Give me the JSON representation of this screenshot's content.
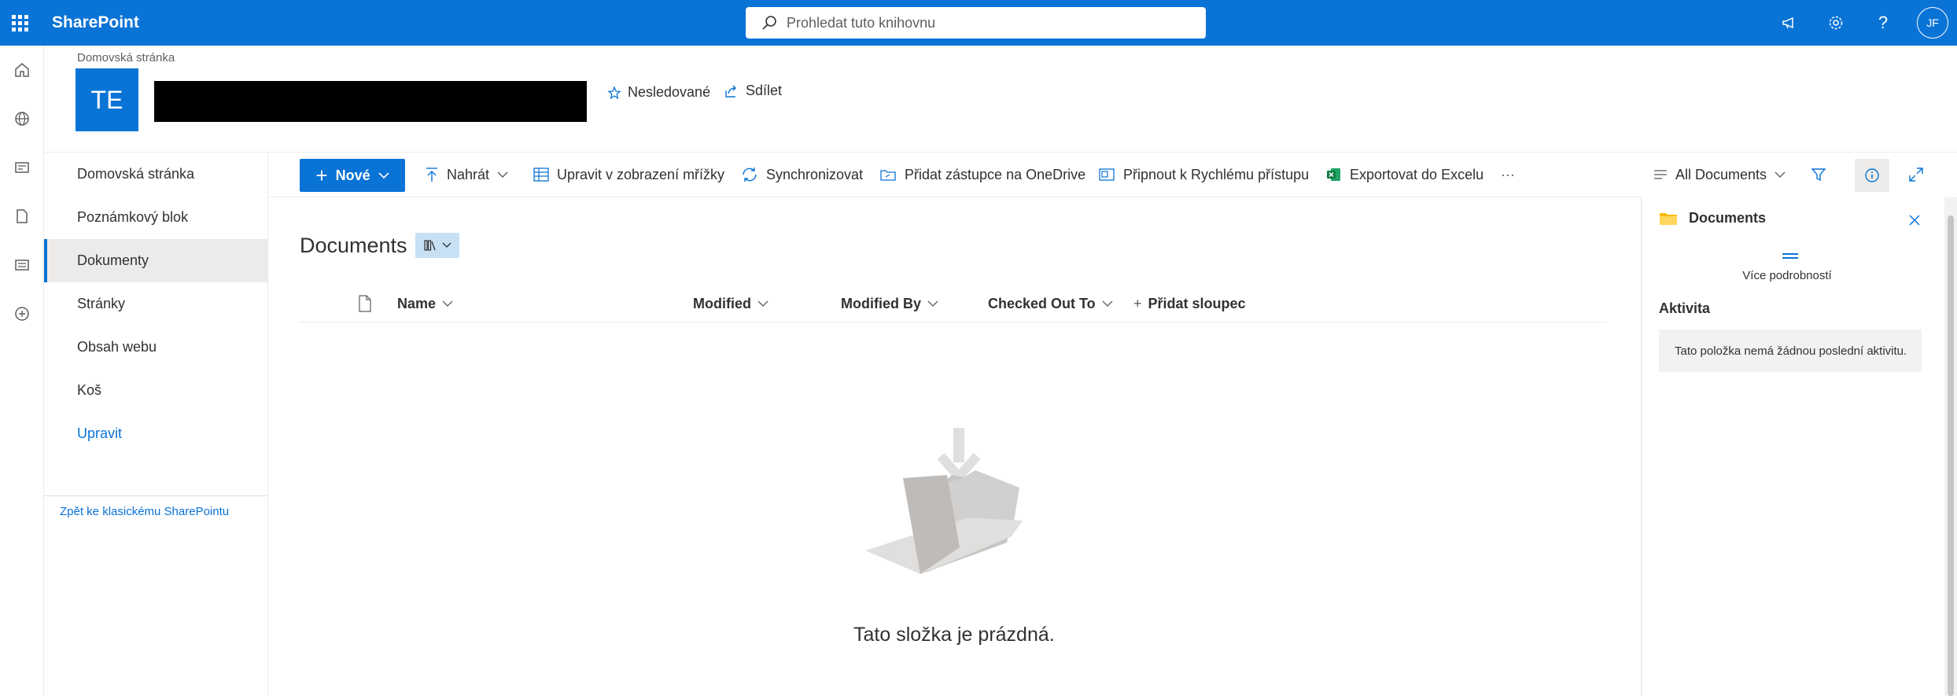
{
  "suitebar": {
    "brand": "SharePoint",
    "search_placeholder": "Prohledat tuto knihovnu",
    "avatar_initials": "JF",
    "accent": "#0a73d6"
  },
  "site": {
    "breadcrumb": "Domovská stránka",
    "logo_initials": "TE",
    "follow_label": "Nesledované",
    "share_label": "Sdílet"
  },
  "nav": {
    "items": [
      {
        "label": "Domovská stránka",
        "active": false
      },
      {
        "label": "Poznámkový blok",
        "active": false
      },
      {
        "label": "Dokumenty",
        "active": true
      },
      {
        "label": "Stránky",
        "active": false
      },
      {
        "label": "Obsah webu",
        "active": false
      },
      {
        "label": "Koš",
        "active": false
      }
    ],
    "edit_label": "Upravit",
    "classic_link": "Zpět ke klasickému SharePointu"
  },
  "commands": {
    "new_label": "Nové",
    "upload_label": "Nahrát",
    "grid_edit_label": "Upravit v zobrazení mřížky",
    "sync_label": "Synchronizovat",
    "onedrive_label": "Přidat zástupce na OneDrive",
    "pin_label": "Připnout k Rychlému přístupu",
    "export_label": "Exportovat do Excelu",
    "more_label": "···",
    "view_label": "All Documents"
  },
  "library": {
    "title": "Documents",
    "columns": [
      "Name",
      "Modified",
      "Modified By",
      "Checked Out To"
    ],
    "add_column_label": "Přidat sloupec",
    "empty_message": "Tato složka je prázdná."
  },
  "details_pane": {
    "title": "Documents",
    "more_details": "Více podrobností",
    "activity_title": "Aktivita",
    "activity_empty": "Tato položka nemá žádnou poslední aktivitu."
  }
}
